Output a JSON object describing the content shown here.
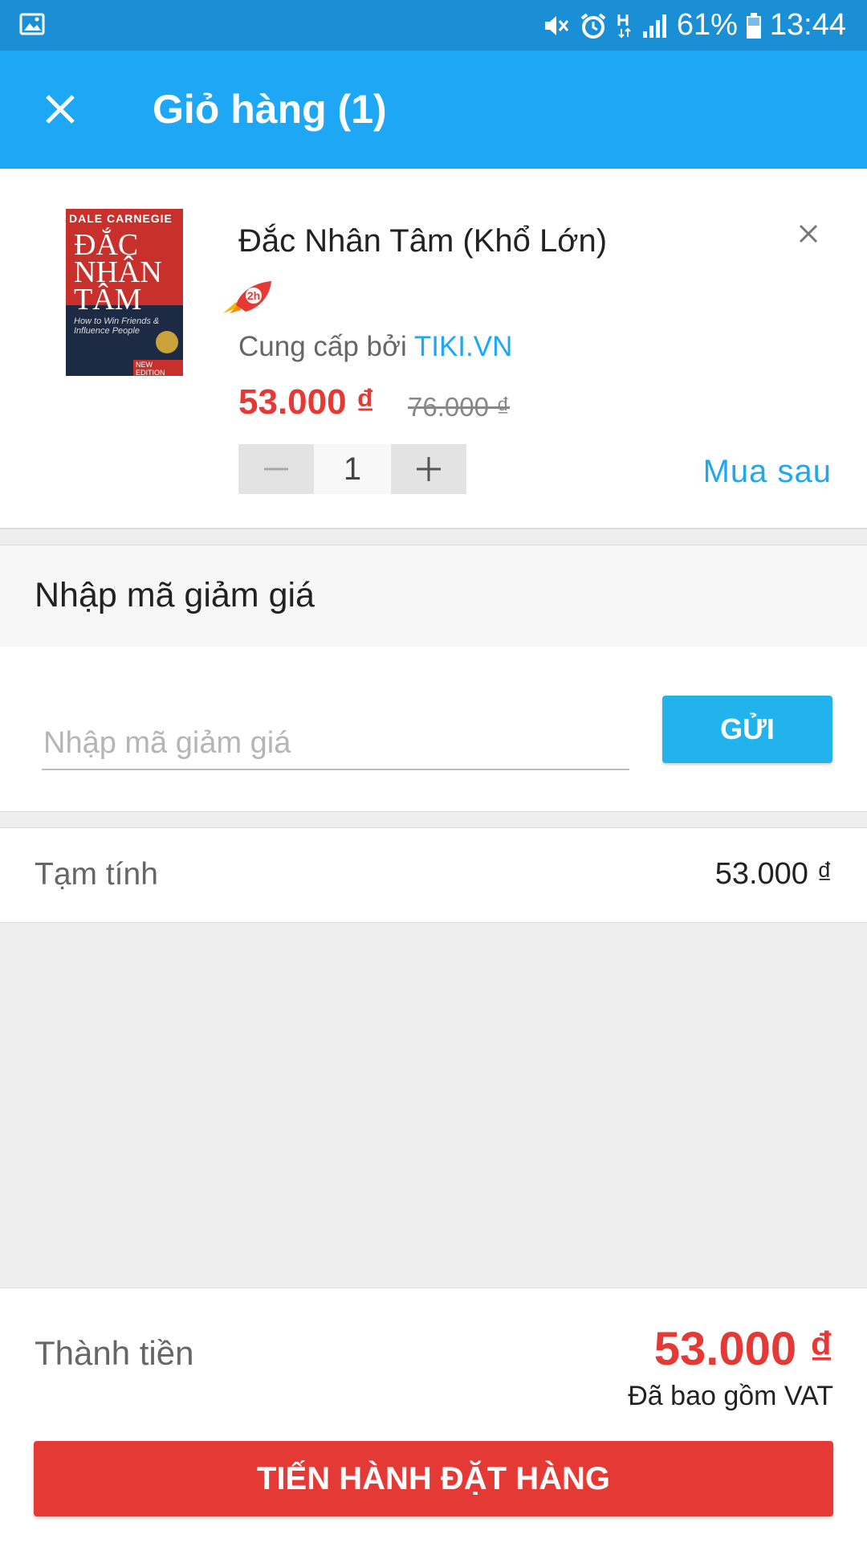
{
  "status_bar": {
    "battery": "61%",
    "time": "13:44",
    "icons": [
      "gallery-icon",
      "mute-icon",
      "alarm-icon",
      "data-hplus-icon",
      "signal-icon",
      "battery-icon"
    ]
  },
  "app_bar": {
    "title": "Giỏ hàng (1)",
    "close_icon": "close-icon"
  },
  "cart": {
    "items": [
      {
        "cover_author": "DALE CARNEGIE",
        "cover_title": "ĐẮC NHÂN TÂM",
        "cover_subtitle": "How to Win Friends & Influence People",
        "cover_edition": "NEW EDITION",
        "name": "Đắc Nhân Tâm (Khổ Lớn)",
        "badge": "2h",
        "supplier_prefix": "Cung cấp bởi",
        "supplier": "TIKI.VN",
        "price": "53.000 ₫",
        "old_price": "76.000 ₫",
        "quantity": "1",
        "buy_later_label": "Mua sau"
      }
    ]
  },
  "coupon": {
    "heading": "Nhập mã giảm giá",
    "placeholder": "Nhập mã giảm giá",
    "value": "",
    "submit_label": "GỬI"
  },
  "subtotal": {
    "label": "Tạm tính",
    "value": "53.000 ₫"
  },
  "summary": {
    "label": "Thành tiền",
    "total": "53.000 ₫",
    "vat_note": "Đã bao gồm VAT",
    "checkout_label": "TIẾN HÀNH ĐẶT HÀNG"
  },
  "colors": {
    "status_bar": "#1b8fd6",
    "app_bar": "#1ea7f4",
    "price_red": "#e53935",
    "link_blue": "#1ea7f4",
    "send_button": "#22b3ec"
  }
}
